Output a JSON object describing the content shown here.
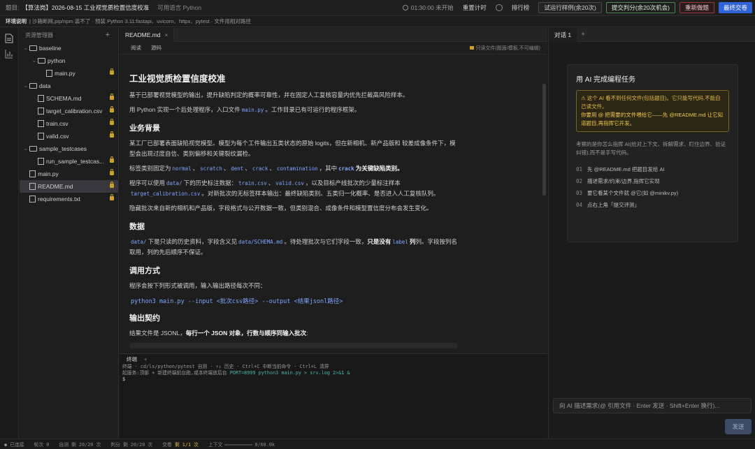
{
  "topbar": {
    "label": "题目:",
    "title": "【算法岗】2026-08-15 工业视觉质检置信度校准",
    "lang": "可用语言 Python",
    "timer": "01:30:00 未开始",
    "reset": "重置计时",
    "ranking": "排行榜",
    "trial_run": "试运行样例(余20次)",
    "submit_score": "提交判分(余20次机会)",
    "retry": "重新做题",
    "final_submit": "最终交卷"
  },
  "envbar": {
    "label": "环境说明",
    "text": "| 沙箱断网,pip/npm 装不了 · 预装 Python 3.11:fastapi、uvicorn、httpx、pytest · 文件用相对路径"
  },
  "explorer": {
    "title": "资源管理器",
    "items": [
      {
        "name": "baseline",
        "type": "folder",
        "depth": 0,
        "open": true
      },
      {
        "name": "python",
        "type": "folder",
        "depth": 1,
        "open": true
      },
      {
        "name": "main.py",
        "type": "file",
        "depth": 2,
        "lock": true
      },
      {
        "name": "data",
        "type": "folder",
        "depth": 0,
        "open": true
      },
      {
        "name": "SCHEMA.md",
        "type": "file",
        "depth": 1,
        "lock": true
      },
      {
        "name": "target_calibration.csv",
        "type": "file",
        "depth": 1,
        "lock": true
      },
      {
        "name": "train.csv",
        "type": "file",
        "depth": 1,
        "lock": true
      },
      {
        "name": "valid.csv",
        "type": "file",
        "depth": 1,
        "lock": true
      },
      {
        "name": "sample_testcases",
        "type": "folder",
        "depth": 0,
        "open": true
      },
      {
        "name": "run_sample_testcas...",
        "type": "file",
        "depth": 1,
        "lock": true
      },
      {
        "name": "main.py",
        "type": "file",
        "depth": 0,
        "lock": true
      },
      {
        "name": "README.md",
        "type": "file",
        "depth": 0,
        "lock": true,
        "selected": true
      },
      {
        "name": "requirements.txt",
        "type": "file",
        "depth": 0,
        "lock": true
      }
    ]
  },
  "editor": {
    "tab": "README.md",
    "mode_read": "阅读",
    "mode_source": "源码",
    "readonly": "只读文件(题面/模板,不可编辑)"
  },
  "doc": {
    "h1": "工业视觉质检置信度校准",
    "p1": "基于已部署视觉模型的输出，提升缺陷判定的概率可靠性，并在固定人工复核容量内优先拦截高风险样本。",
    "p2a": "用 Python 实现一个后处理程序，入口文件",
    "p2code": "main.py",
    "p2b": "。工作目录已有可运行的程序框架。",
    "h2a": "业务背景",
    "p3": "某工厂已部署表面缺陷视觉模型。模型为每个工件输出五类状态的原始 logits，但在新相机、新产品版和 较差成像条件下，模型会出现过度自信、类别偏移和关键裂纹漏检。",
    "p4a": "标签类别固定为",
    "c_normal": "normal",
    "c_scratch": "scratch",
    "c_dent": "dent",
    "c_crack": "crack",
    "c_contam": "contamination",
    "p4b": "，其中",
    "p4crack": "crack",
    "p4c": "为关键缺陷类别。",
    "p5a": "程序可以使用",
    "p5code1": "data/",
    "p5b": "下的历史标注数据：",
    "p5code2": "train.csv",
    "p5code3": "valid.csv",
    "p5c": "，以及目标产线批次的少量标注样本",
    "p5code4": "target_calibration.csv",
    "p5d": "。对新批次的无标签样本输出：最终缺陷类别、五类归一化概率、是否进入人工复核队列。",
    "p6": "隐藏批次来自新的相机和产品版，字段格式与公开数据一致，但类别混合、成像条件和模型置信度分布会发生变化。",
    "h2b": "数据",
    "p7code1": "data/",
    "p7a": "下是只读的历史资料，字段含义见",
    "p7code2": "data/SCHEMA.md",
    "p7b": "。待处理批次与它们字段一致，",
    "p7bold": "只是没有",
    "p7code3": "label",
    "p7c": "列。字段按列名取用，列的先后顺序不保证。",
    "h2c": "调用方式",
    "p8": "程序会按下列形式被调用，输入输出路径每次不同：",
    "cmd": "python3 main.py --input <批次csv路径> --output <结果jsonl路径>",
    "h2d": "输出契约",
    "p9a": "结果文件是 JSONL，",
    "p9bold": "每行一个 JSON 对象，行数与顺序同输入批次",
    "p9b": ":"
  },
  "terminal": {
    "tab": "终端",
    "plus": "+",
    "line1": "终端 · cd/ls/python/pytest 自测 · ↑↓ 历史 · Ctrl+C 中断当前命令 · Ctrl+L 清屏",
    "line2a": "起服务:顶部 + 新建终端前台跑,或本终端放后台",
    "line2b": "PORT=8999 python3 main.py > srv.log 2>&1 &",
    "prompt": "$"
  },
  "chat": {
    "tab": "对话 1",
    "plus": "+",
    "card_title": "用 AI 完成编程任务",
    "warn_line1": "⚠ 这个 AI 看不到任何文件(包括题目)。它只能写代码,不能自己读文件。",
    "warn_line2": "你要用 @ 把需要的文件喂给它——先 @README.md 让它知道题目,再指挥它开发。",
    "desc": "考察的是你怎么指挥 AI(给对上下文、拆解需求、盯住边界、验证纠错),而不是手写代码。",
    "steps": [
      {
        "n": "01",
        "text": "先 @README.md 把题目发给 AI"
      },
      {
        "n": "02",
        "text": "描述需求/约束/边界,指挥它实现"
      },
      {
        "n": "03",
        "text": "要它看某个文件就 @它(如 @minikv.py)"
      },
      {
        "n": "04",
        "text": "点右上角「提交评测」"
      }
    ],
    "input_placeholder": "向 AI 描述需求(@ 引用文件 · Enter 发送 · Shift+Enter 换行)...",
    "send": "发送"
  },
  "status": {
    "conn": "● 已连接",
    "rounds": "轮次 0",
    "selftest": "自测 剩 20/20 次",
    "judge": "判分 剩 20/20 次",
    "submit_a": "交卷",
    "submit_b": "剩 1/1 次",
    "context": "上下文",
    "context_val": "0/60.0k"
  }
}
